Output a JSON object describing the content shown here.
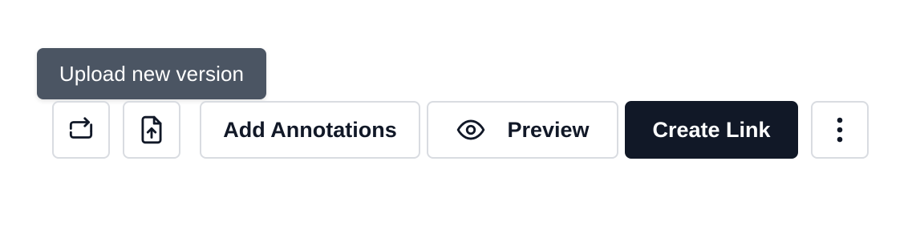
{
  "tooltip": {
    "text": "Upload new version"
  },
  "toolbar": {
    "replace_icon": "replace-file-icon",
    "upload_icon": "file-upload-icon",
    "add_annotations_label": "Add Annotations",
    "preview_label": "Preview",
    "preview_icon": "eye-icon",
    "create_link_label": "Create Link",
    "more_icon": "vertical-dots-icon"
  },
  "colors": {
    "tooltip_bg": "#4b5563",
    "primary_bg": "#111827",
    "border": "#d9dce1",
    "text": "#111827"
  }
}
